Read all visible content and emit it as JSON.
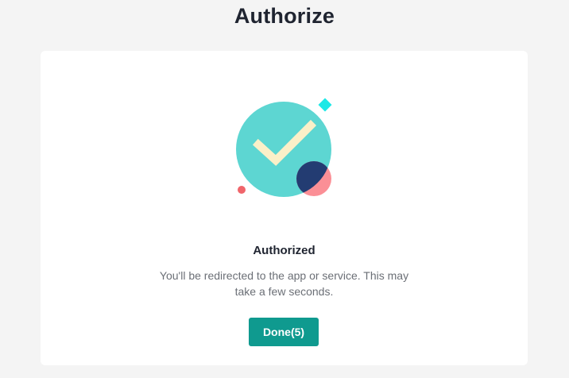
{
  "page": {
    "title": "Authorize"
  },
  "status": {
    "heading": "Authorized",
    "message": "You'll be redirected to the app or service. This may take a few seconds."
  },
  "actions": {
    "done_label": "Done(5)"
  },
  "illustration": {
    "icon": "success-check-icon",
    "colors": {
      "circle": "#5dd6d2",
      "check": "#fbf0c8",
      "navy": "#233c72",
      "pink": "#fb8f96",
      "diamond": "#1ce8e6",
      "dot": "#f0656b"
    }
  },
  "theme": {
    "background": "#f4f4f4",
    "card": "#ffffff",
    "accent": "#0f9a8f",
    "text": "#1f2430",
    "muted_text": "#6b6f76"
  }
}
